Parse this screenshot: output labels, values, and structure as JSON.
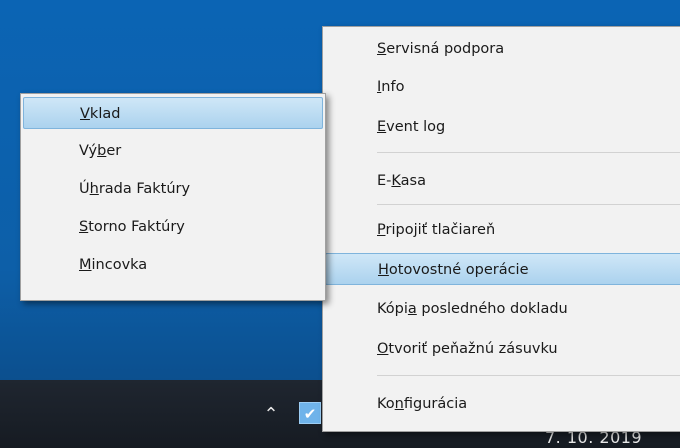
{
  "main_menu": {
    "items": [
      {
        "pre": "",
        "key": "S",
        "post": "ervisná podpora"
      },
      {
        "pre": "",
        "key": "I",
        "post": "nfo"
      },
      {
        "pre": "",
        "key": "E",
        "post": "vent log"
      },
      {
        "pre": "E-",
        "key": "K",
        "post": "asa"
      },
      {
        "pre": "",
        "key": "P",
        "post": "ripojiť tlačiareň"
      },
      {
        "pre": "",
        "key": "H",
        "post": "otovostné operácie"
      },
      {
        "pre": "Kópi",
        "key": "a",
        "post": " posledného dokladu"
      },
      {
        "pre": "",
        "key": "O",
        "post": "tvoriť peňažnú zásuvku"
      },
      {
        "pre": "Ko",
        "key": "n",
        "post": "figurácia"
      }
    ],
    "selected_index": 5
  },
  "sub_menu": {
    "items": [
      {
        "pre": "",
        "key": "V",
        "post": "klad"
      },
      {
        "pre": "Vý",
        "key": "b",
        "post": "er"
      },
      {
        "pre": "Ú",
        "key": "h",
        "post": "rada Faktúry"
      },
      {
        "pre": "",
        "key": "S",
        "post": "torno Faktúry"
      },
      {
        "pre": "",
        "key": "M",
        "post": "incovka"
      }
    ],
    "selected_index": 0
  },
  "taskbar": {
    "tray_chevron_icon": "chevron-up-icon",
    "tray_app_icon": "pos-app-icon",
    "clock_date": "7. 10. 2019"
  }
}
